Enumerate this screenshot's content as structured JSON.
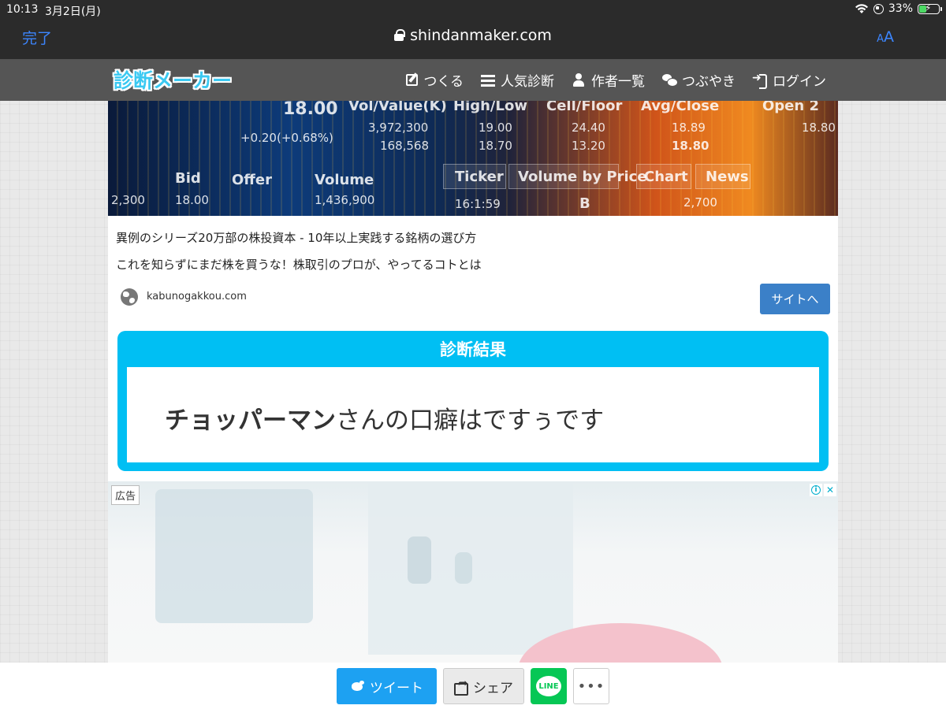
{
  "status_bar": {
    "time": "10:13",
    "date": "3月2日(月)",
    "battery": "33%",
    "battery_level": 0.33
  },
  "browser": {
    "done_label": "完了",
    "url": "shindanmaker.com",
    "aa_big": "A",
    "aa_small": "A",
    "accent_color": "#3c86ff"
  },
  "site_nav": {
    "logo": "診断メーカー",
    "items": [
      {
        "label": "つくる",
        "icon": "edit-icon"
      },
      {
        "label": "人気診断",
        "icon": "list-icon"
      },
      {
        "label": "作者一覧",
        "icon": "user-icon"
      },
      {
        "label": "つぶやき",
        "icon": "chat-icon"
      },
      {
        "label": "ログイン",
        "icon": "login-icon"
      }
    ]
  },
  "ad_top": {
    "banner_texts": {
      "price1": "18.00",
      "vol_value": "Vol/Value(K)",
      "high_low": "High/Low",
      "cell_floor": "Cell/Floor",
      "avg_close": "Avg/Close",
      "open2": "Open 2",
      "change": "+0.20(+0.68%)",
      "v1": "3,972,300",
      "v2": "168,568",
      "h1": "19.00",
      "h2": "18.70",
      "c1": "24.40",
      "c2": "13.20",
      "a1": "18.89",
      "a2": "18.80",
      "o1": "18.80",
      "bid": "Bid",
      "offer": "Offer",
      "volume": "Volume",
      "ticker": "Ticker",
      "volume_by_price": "Volume by Price",
      "chart": "Chart",
      "news": "News",
      "bottom1": "2,300",
      "bottom2": "18.00",
      "bottom3": "1,436,900",
      "bottom4": "16:1:59",
      "bottom5": "B",
      "bottom6": "2,700"
    },
    "title": "異例のシリーズ20万部の株投資本 - 10年以上実践する銘柄の選び方",
    "description": "これを知らずにまだ株を買うな！株取引のプロが、やってるコトとは",
    "domain": "kabunogakkou.com",
    "cta": "サイトへ"
  },
  "result": {
    "header": "診断結果",
    "name": "チョッパーマン",
    "text": "さんの口癖はですぅです",
    "frame_color": "#00bff3"
  },
  "ad_bottom": {
    "label": "広告",
    "info_icon": "i",
    "close_icon": "✕"
  },
  "share": {
    "tweet": "ツイート",
    "share": "シェア",
    "line": "LINE",
    "more": "•••",
    "tweet_color": "#1da1f2",
    "line_color": "#06c755"
  }
}
